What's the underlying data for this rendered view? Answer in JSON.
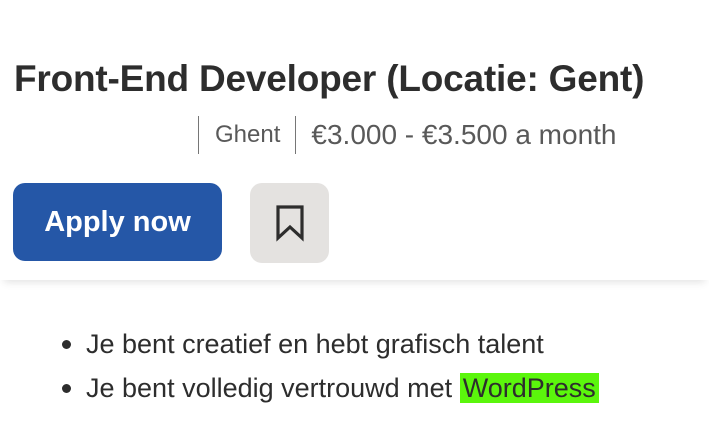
{
  "job": {
    "title": "Front-End Developer (Locatie: Gent)",
    "location": "Ghent",
    "salary": "€3.000 - €3.500 a month"
  },
  "actions": {
    "apply_label": "Apply now",
    "save_icon": "bookmark-icon"
  },
  "description": {
    "bullets": [
      {
        "text": "Je bent creatief en hebt grafisch talent"
      },
      {
        "text_before": "Je bent volledig vertrouwd met ",
        "highlight": "WordPress"
      }
    ]
  },
  "colors": {
    "apply_button": "#2557a7",
    "save_button": "#e4e2e0",
    "highlight": "#5bf60c",
    "text": "#2d2d2d",
    "muted_text": "#595959"
  }
}
